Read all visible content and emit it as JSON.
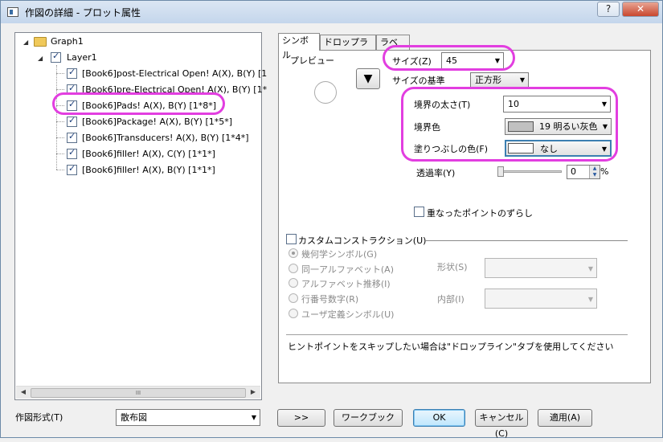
{
  "window": {
    "title": "作図の詳細 - プロット属性",
    "help_button": "?",
    "close_button": "✕"
  },
  "tree": {
    "graph_label": "Graph1",
    "layer_label": "Layer1",
    "plots": [
      "[Book6]post-Electrical Open! A(X), B(Y) [1",
      "[Book6]pre-Electrical Open! A(X), B(Y) [1*",
      "[Book6]Pads! A(X), B(Y) [1*8*]",
      "[Book6]Package! A(X), B(Y) [1*5*]",
      "[Book6]Transducers! A(X), B(Y) [1*4*]",
      "[Book6]filler! A(X), C(Y) [1*1*]",
      "[Book6]filler! A(X), B(Y) [1*1*]"
    ],
    "scroll_thumb_label": "III"
  },
  "plot_type": {
    "label": "作図形式(T)",
    "value": "散布図"
  },
  "tabs": [
    "シンボル",
    "ドロップライン",
    "ラベル"
  ],
  "symbol_tab": {
    "preview_label": "プレビュー",
    "size_label": "サイズ(Z)",
    "size_value": "45",
    "size_basis_label": "サイズの基準",
    "size_basis_value": "正方形",
    "edge_thickness_label": "境界の太さ(T)",
    "edge_thickness_value": "10",
    "edge_color_label": "境界色",
    "edge_color_value": "19 明るい灰色",
    "edge_color_swatch": "#c0c0c0",
    "fill_color_label": "塗りつぶしの色(F)",
    "fill_color_value": "なし",
    "transparency_label": "透過率(Y)",
    "transparency_value": "0",
    "transparency_unit": "%",
    "transparency_level": 0,
    "overlap_label": "重なったポイントのずらし",
    "custom_construction_label": "カスタムコンストラクション(U)",
    "radio_options": [
      "幾何学シンボル(G)",
      "同一アルファベット(A)",
      "アルファベット推移(I)",
      "行番号数字(R)",
      "ユーザ定義シンボル(U)"
    ],
    "shape_label": "形状(S)",
    "interior_label": "内部(I)",
    "hint_text": "ヒントポイントをスキップしたい場合は\"ドロップライン\"タブを使用してください"
  },
  "buttons": {
    "more": ">>",
    "workbook": "ワークブック",
    "ok": "OK",
    "cancel": "キャンセル(C)",
    "apply": "適用(A)"
  },
  "highlight_color": "#e23ee0"
}
